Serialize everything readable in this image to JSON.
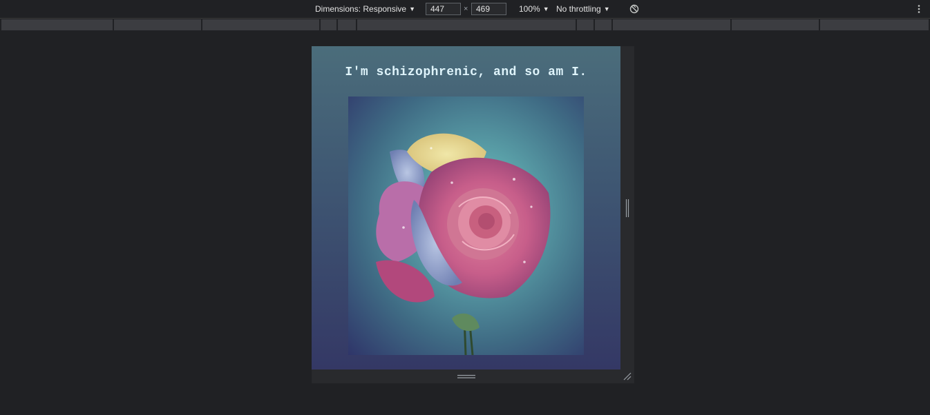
{
  "toolbar": {
    "dimensions_label": "Dimensions: Responsive",
    "width_value": "447",
    "times_symbol": "×",
    "height_value": "469",
    "zoom_label": "100%",
    "throttling_label": "No throttling",
    "icons": [
      "rotate-icon",
      "kebab-menu-icon"
    ]
  },
  "page": {
    "heading": "I'm schizophrenic, and so am I."
  },
  "colors": {
    "devtools_bg": "#202124",
    "heading_text": "#dff4fb",
    "page_bg_top": "#4b6d7b",
    "page_bg_bottom": "#343865"
  }
}
